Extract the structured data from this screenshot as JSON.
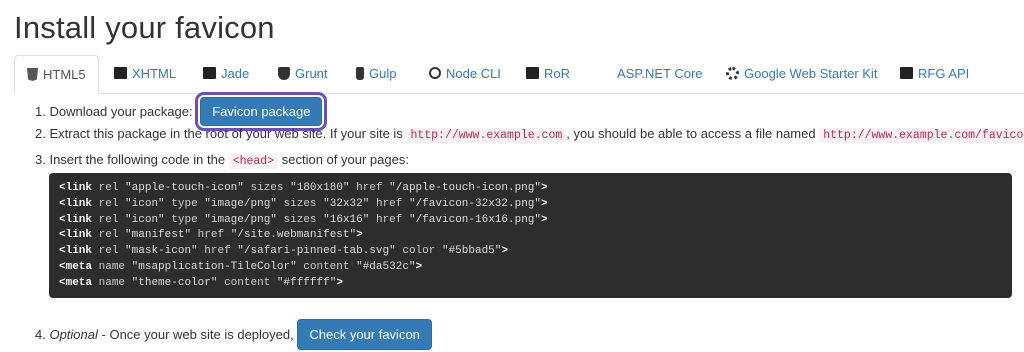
{
  "page": {
    "title": "Install your favicon"
  },
  "tabs": [
    {
      "label": "HTML5",
      "icon": "html5-icon"
    },
    {
      "label": "XHTML",
      "icon": "xhtml-icon"
    },
    {
      "label": "Jade",
      "icon": "jade-icon"
    },
    {
      "label": "Grunt",
      "icon": "grunt-icon"
    },
    {
      "label": "Gulp",
      "icon": "gulp-icon"
    },
    {
      "label": "Node CLI",
      "icon": "node-cli-icon"
    },
    {
      "label": "RoR",
      "icon": "ror-icon"
    },
    {
      "label": "ASP.NET Core",
      "icon": "windows-icon"
    },
    {
      "label": "Google Web Starter Kit",
      "icon": "gear-icon"
    },
    {
      "label": "RFG API",
      "icon": "rfg-api-icon"
    }
  ],
  "steps": {
    "s1": {
      "num": "1.",
      "text": "Download your package:",
      "button": "Favicon package"
    },
    "s2": {
      "num": "2.",
      "text_a": "Extract this package in the root of your web site. If your site is",
      "code_a": "http://www.example.com",
      "text_b": ", you should be able to access a file named",
      "code_b": "http://www.example.com/favicon.ico",
      "text_c": "."
    },
    "s3": {
      "num": "3.",
      "text_a": "Insert the following code in the",
      "code": "<head>",
      "text_b": "section of your pages:"
    },
    "s4": {
      "num": "4.",
      "em": "Optional",
      "text": "- Once your web site is deployed,",
      "button": "Check your favicon"
    }
  },
  "code_lines": [
    {
      "tag": "<link",
      "attrs": [
        [
          "rel",
          "\"apple-touch-icon\""
        ],
        [
          "sizes",
          "\"180x180\""
        ],
        [
          "href",
          "\"/apple-touch-icon.png\""
        ]
      ],
      "end": ">"
    },
    {
      "tag": "<link",
      "attrs": [
        [
          "rel",
          "\"icon\""
        ],
        [
          "type",
          "\"image/png\""
        ],
        [
          "sizes",
          "\"32x32\""
        ],
        [
          "href",
          "\"/favicon-32x32.png\""
        ]
      ],
      "end": ">"
    },
    {
      "tag": "<link",
      "attrs": [
        [
          "rel",
          "\"icon\""
        ],
        [
          "type",
          "\"image/png\""
        ],
        [
          "sizes",
          "\"16x16\""
        ],
        [
          "href",
          "\"/favicon-16x16.png\""
        ]
      ],
      "end": ">"
    },
    {
      "tag": "<link",
      "attrs": [
        [
          "rel",
          "\"manifest\""
        ],
        [
          "href",
          "\"/site.webmanifest\""
        ]
      ],
      "end": ">"
    },
    {
      "tag": "<link",
      "attrs": [
        [
          "rel",
          "\"mask-icon\""
        ],
        [
          "href",
          "\"/safari-pinned-tab.svg\""
        ],
        [
          "color",
          "\"#5bbad5\""
        ]
      ],
      "end": ">"
    },
    {
      "tag": "<meta",
      "attrs": [
        [
          "name",
          "\"msapplication-TileColor\""
        ],
        [
          "content",
          "\"#da532c\""
        ]
      ],
      "end": ">"
    },
    {
      "tag": "<meta",
      "attrs": [
        [
          "name",
          "\"theme-color\""
        ],
        [
          "content",
          "\"#ffffff\""
        ]
      ],
      "end": ">"
    }
  ],
  "colors": {
    "accent": "#337ab7",
    "highlight": "#6b4fbb",
    "code_bg": "#2d2d2d",
    "inline_code": "#c7254e"
  }
}
